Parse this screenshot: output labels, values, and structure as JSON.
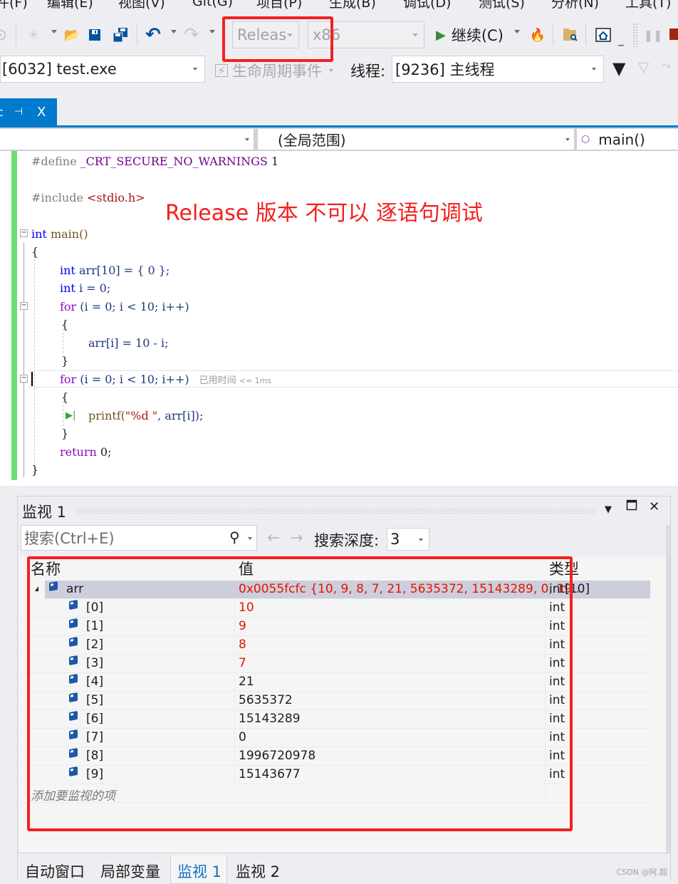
{
  "menu": {
    "items": [
      "件(F)",
      "编辑(E)",
      "视图(V)",
      "Git(G)",
      "项目(P)",
      "生成(B)",
      "调试(D)",
      "测试(S)",
      "分析(N)",
      "工具(T)"
    ]
  },
  "toolbar": {
    "configuration": "Releas",
    "platform": "x86",
    "continue_label": "继续(C)",
    "icons": [
      "forward-nav-icon",
      "new-item-icon",
      "open-folder-icon",
      "save-icon",
      "save-all-icon",
      "undo-icon",
      "redo-icon",
      "play-icon",
      "hot-reload-icon",
      "find-in-files-icon",
      "home-window-icon",
      "pause-icon",
      "stop-icon"
    ]
  },
  "debug_bar": {
    "process": "[6032] test.exe",
    "lifecycle_events": "生命周期事件",
    "thread_label": "线程:",
    "thread": "[9236] 主线程"
  },
  "document_tab": {
    "pin_glyph": "⊣",
    "close_glyph": "X"
  },
  "navbar": {
    "project": "",
    "scope": "(全局范围)",
    "member": "main()"
  },
  "editor": {
    "lines": {
      "define_kw": "#define",
      "define_macro": "_CRT_SECURE_NO_WARNINGS",
      "define_value": "1",
      "include_kw": "#include",
      "include_file": "<stdio.h>",
      "main_type": "int",
      "main_name": " main()",
      "open_brace": "{",
      "arr_type": "int",
      "arr_decl": " arr[10] = { 0 };",
      "i_type": "int",
      "i_decl": " i = 0;",
      "for1_kw": "for",
      "for1_rest": " (i = 0; i < 10; i++)",
      "for1_open": "{",
      "assign": "arr[i] = 10 - i;",
      "for1_close": "}",
      "for2_kw": "for",
      "for2_rest": " (i = 0; i < 10; i++)",
      "for2_open": "{",
      "printf_fn": "printf(",
      "printf_str": "\"%d \"",
      "printf_rest": ", arr[i]);",
      "for2_close": "}",
      "return_kw": "return",
      "return_rest": " 0;",
      "close_brace": "}"
    },
    "perf_tip": "已用时间",
    "perf_tip_value": "<= 1ms",
    "annotation": "Release 版本 不可以 逐语句调试"
  },
  "watch": {
    "title": "监视 1",
    "search_placeholder": "搜索(Ctrl+E)",
    "depth_label": "搜索深度:",
    "depth_value": "3",
    "columns": [
      "名称",
      "值",
      "类型"
    ],
    "root": {
      "name": "arr",
      "value": "0x0055fcfc {10, 9, 8, 7, 21, 5635372, 15143289, 0, 19...",
      "type": "int[10]"
    },
    "items": [
      {
        "name": "[0]",
        "value": "10",
        "type": "int",
        "changed": true
      },
      {
        "name": "[1]",
        "value": "9",
        "type": "int",
        "changed": true
      },
      {
        "name": "[2]",
        "value": "8",
        "type": "int",
        "changed": true
      },
      {
        "name": "[3]",
        "value": "7",
        "type": "int",
        "changed": true
      },
      {
        "name": "[4]",
        "value": "21",
        "type": "int",
        "changed": false
      },
      {
        "name": "[5]",
        "value": "5635372",
        "type": "int",
        "changed": false
      },
      {
        "name": "[6]",
        "value": "15143289",
        "type": "int",
        "changed": false
      },
      {
        "name": "[7]",
        "value": "0",
        "type": "int",
        "changed": false
      },
      {
        "name": "[8]",
        "value": "1996720978",
        "type": "int",
        "changed": false
      },
      {
        "name": "[9]",
        "value": "15143677",
        "type": "int",
        "changed": false
      }
    ],
    "add_item_placeholder": "添加要监视的项",
    "bottom_tabs": [
      "自动窗口",
      "局部变量",
      "监视 1",
      "监视 2"
    ],
    "active_tab": "监视 1"
  },
  "watermark": "CSDN @阿.超",
  "colors": {
    "accent": "#007acc",
    "changed_value": "#e51400",
    "annotation": "#f41e1e",
    "change_bar": "#6fdc6f"
  }
}
